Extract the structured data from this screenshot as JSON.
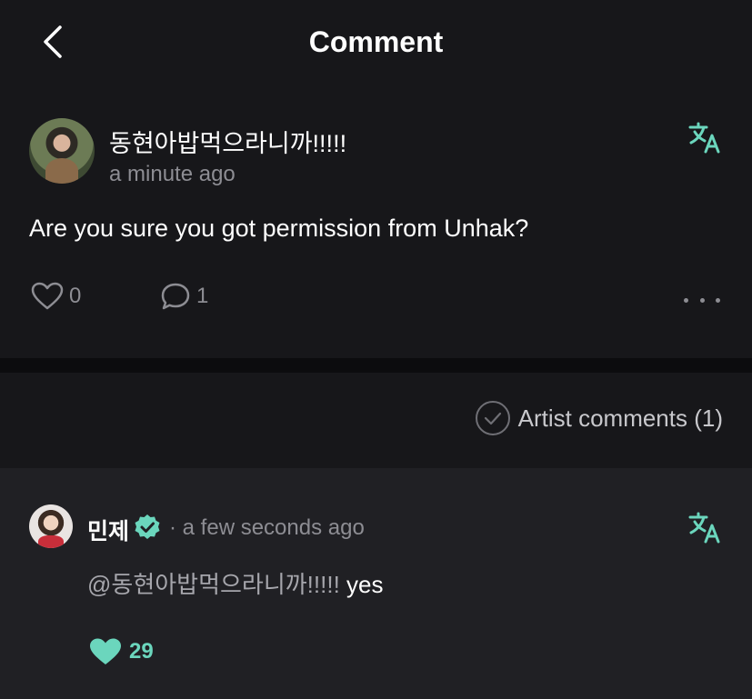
{
  "header": {
    "title": "Comment"
  },
  "post": {
    "username": "동현아밥먹으라니까!!!!!",
    "timestamp": "a minute ago",
    "text": "Are you sure you got permission from Unhak?",
    "likes": "0",
    "replies": "1"
  },
  "filter": {
    "artist_comments_label": "Artist comments (1)"
  },
  "reply": {
    "username": "민제",
    "timestamp": "· a few seconds ago",
    "mention": "@동현아밥먹으라니까!!!!!",
    "text": " yes",
    "likes": "29"
  },
  "colors": {
    "accent": "#6bd6bd",
    "background": "#17171a",
    "reply_background": "#202024"
  },
  "icons": [
    "back-chevron",
    "translate",
    "heart",
    "comment-bubble",
    "more-dots",
    "check-circle",
    "verified-badge",
    "heart-filled"
  ]
}
